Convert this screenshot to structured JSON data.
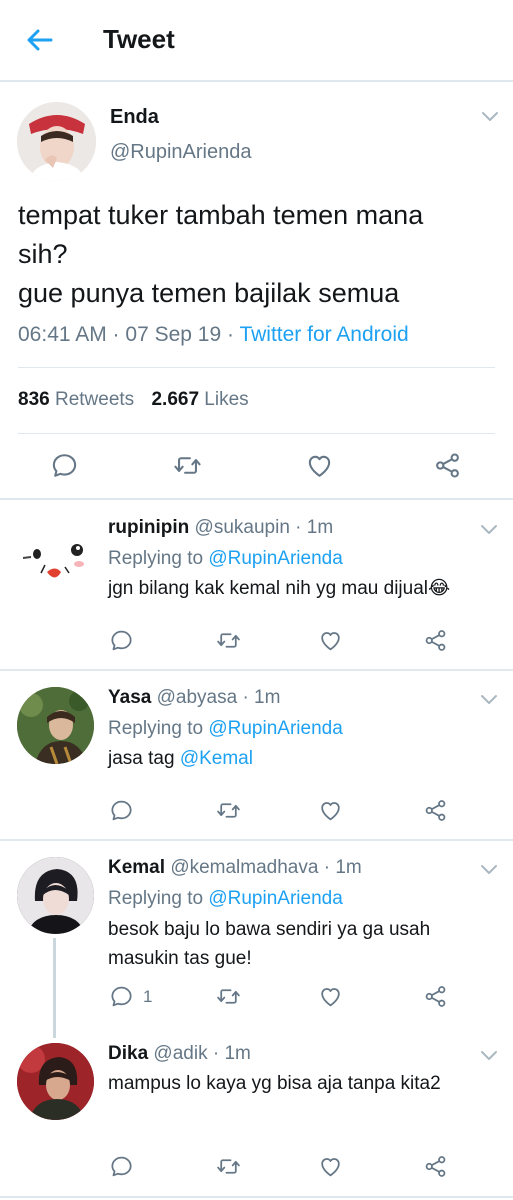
{
  "header": {
    "title": "Tweet"
  },
  "tweet": {
    "name": "Enda",
    "handle": "@RupinArienda",
    "text_line1": "tempat tuker tambah temen mana",
    "text_line2": "sih?",
    "text_line3": "gue punya temen bajilak semua",
    "time": "06:41 AM · 07 Sep 19 · ",
    "source": "Twitter for Android",
    "retweets_count": "836",
    "retweets_label": "Retweets",
    "likes_count": "2.667",
    "likes_label": "Likes"
  },
  "replies": [
    {
      "name": "rupinipin",
      "handle": "@sukaupin · 1m",
      "replying_prefix": "Replying to ",
      "replying_to": "@RupinArienda",
      "text1": "jgn bilang kak kemal nih yg mau dijual😂",
      "text2": "",
      "reply_count": ""
    },
    {
      "name": "Yasa",
      "handle": "@abyasa · 1m",
      "replying_prefix": "Replying to ",
      "replying_to": "@RupinArienda",
      "text1": "jasa tag ",
      "mention": "@Kemal",
      "text2": "",
      "reply_count": ""
    },
    {
      "name": "Kemal",
      "handle": "@kemalmadhava · 1m",
      "replying_prefix": "Replying to ",
      "replying_to": "@RupinArienda",
      "text1": "besok baju lo bawa sendiri ya ga usah",
      "text2": "masukin tas gue!",
      "reply_count": "1"
    },
    {
      "name": "Dika",
      "handle": "@adik · 1m",
      "text1": "mampus lo kaya yg bisa aja tanpa kita2",
      "text2": "",
      "reply_count": ""
    }
  ],
  "colors": {
    "accent": "#1da1f2",
    "secondary_text": "#657786",
    "divider": "#e1e8ed",
    "primary_text": "#14171a"
  },
  "icons": [
    "back-arrow-icon",
    "chevron-down-icon",
    "reply-icon",
    "retweet-icon",
    "like-icon",
    "share-icon"
  ]
}
